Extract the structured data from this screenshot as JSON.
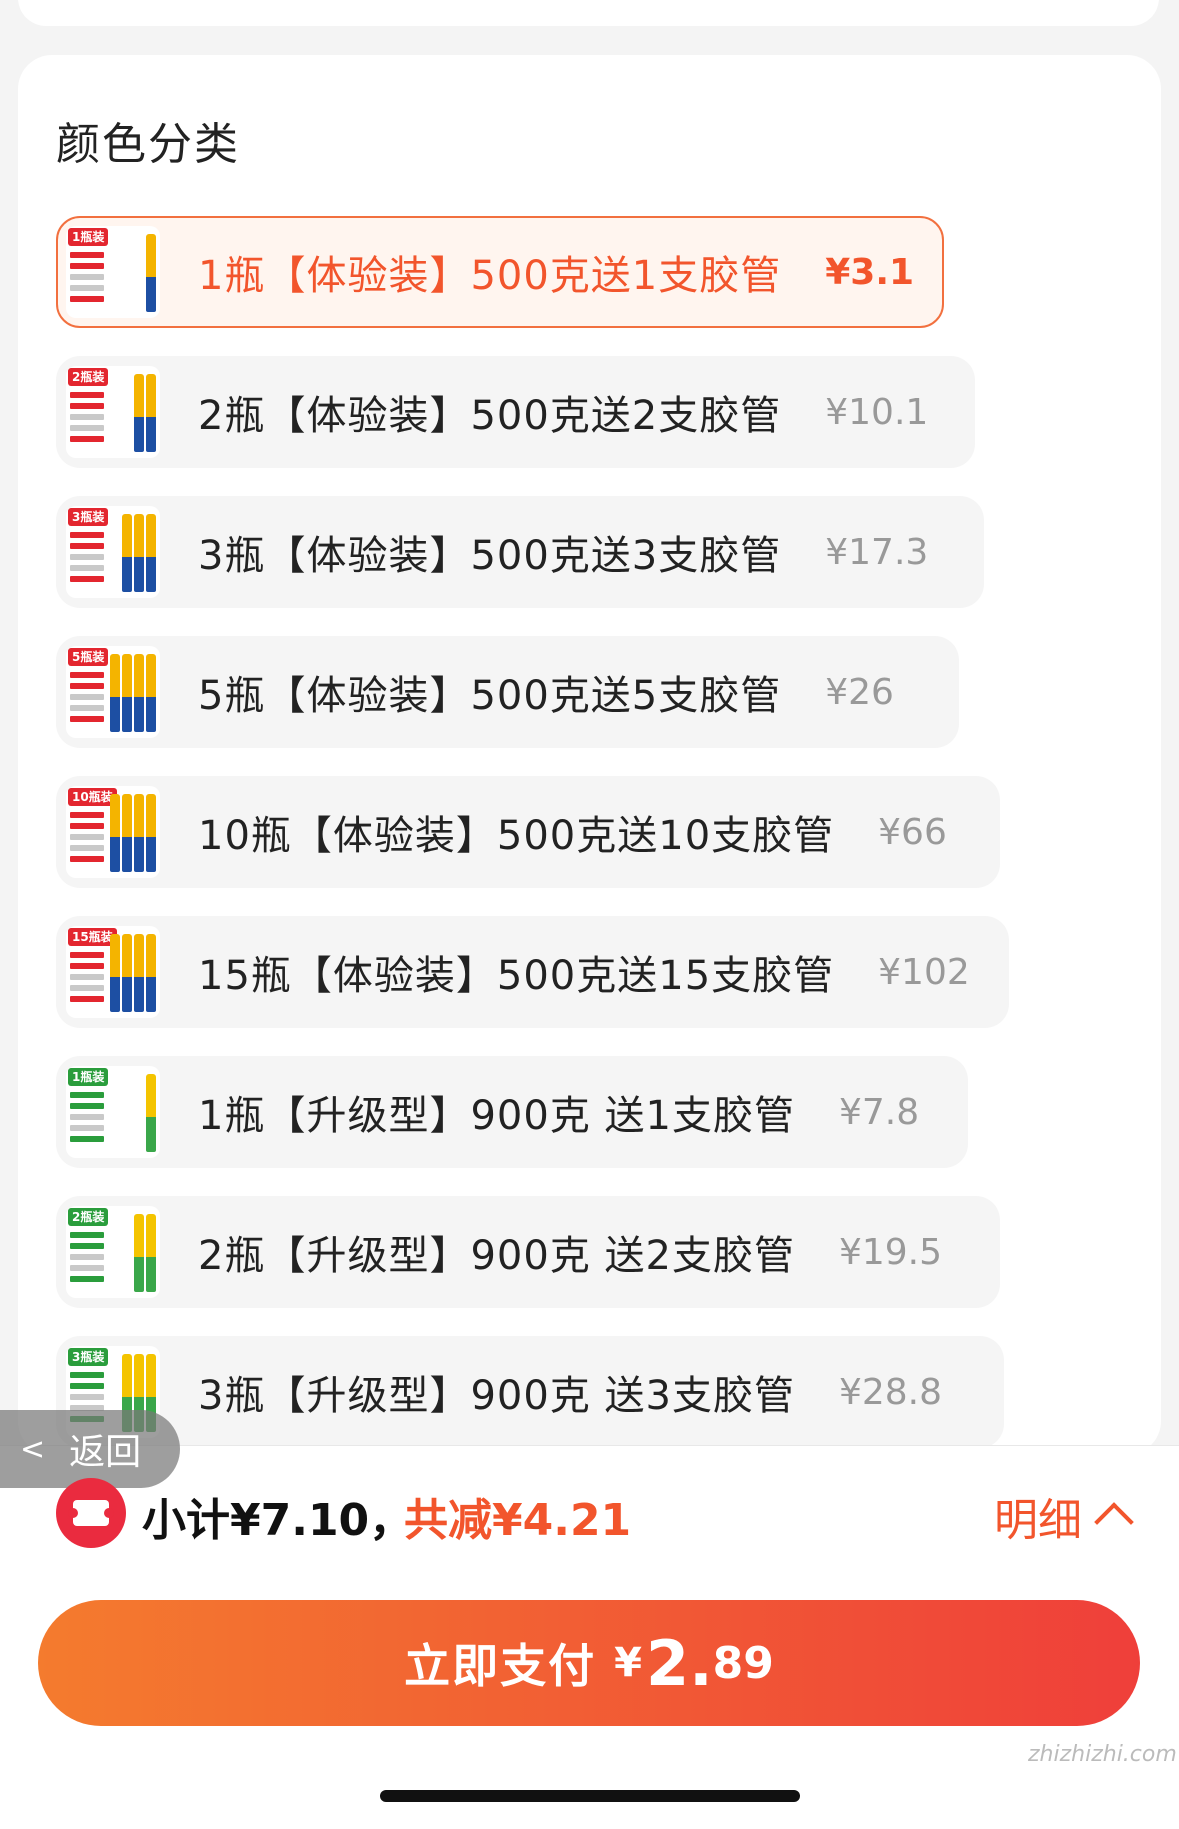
{
  "section": {
    "title": "颜色分类"
  },
  "options": [
    {
      "label": "1瓶【体验装】500克送1支胶管",
      "price": "¥3.1",
      "selected": true,
      "tag": "1瓶装",
      "theme": "orange",
      "cans": 1
    },
    {
      "label": "2瓶【体验装】500克送2支胶管",
      "price": "¥10.1",
      "selected": false,
      "tag": "2瓶装",
      "theme": "orange",
      "cans": 2
    },
    {
      "label": "3瓶【体验装】500克送3支胶管",
      "price": "¥17.3",
      "selected": false,
      "tag": "3瓶装",
      "theme": "orange",
      "cans": 3
    },
    {
      "label": "5瓶【体验装】500克送5支胶管",
      "price": "¥26",
      "selected": false,
      "tag": "5瓶装",
      "theme": "orange",
      "cans": 4
    },
    {
      "label": "10瓶【体验装】500克送10支胶管",
      "price": "¥66",
      "selected": false,
      "tag": "10瓶装",
      "theme": "orange",
      "cans": 4
    },
    {
      "label": "15瓶【体验装】500克送15支胶管",
      "price": "¥102",
      "selected": false,
      "tag": "15瓶装",
      "theme": "orange",
      "cans": 4
    },
    {
      "label": "1瓶【升级型】900克 送1支胶管",
      "price": "¥7.8",
      "selected": false,
      "tag": "1瓶装",
      "theme": "green",
      "cans": 1
    },
    {
      "label": "2瓶【升级型】900克 送2支胶管",
      "price": "¥19.5",
      "selected": false,
      "tag": "2瓶装",
      "theme": "green",
      "cans": 2
    },
    {
      "label": "3瓶【升级型】900克 送3支胶管",
      "price": "¥28.8",
      "selected": false,
      "tag": "3瓶装",
      "theme": "green",
      "cans": 3
    }
  ],
  "back": {
    "label": "返回"
  },
  "summary": {
    "subtotal": "小计¥7.10，",
    "discount": "共减¥4.21",
    "detail": "明细"
  },
  "pay": {
    "label": "立即支付",
    "currency": "¥",
    "integer": "2.",
    "decimal": "89"
  },
  "watermark": "zhizhizhi.com",
  "colors": {
    "accent": "#f2552c",
    "selected_border": "#f2703f",
    "pay_gradient_start": "#f47b2e",
    "pay_gradient_end": "#ef3f3a",
    "coupon_red": "#ea2b3f"
  }
}
